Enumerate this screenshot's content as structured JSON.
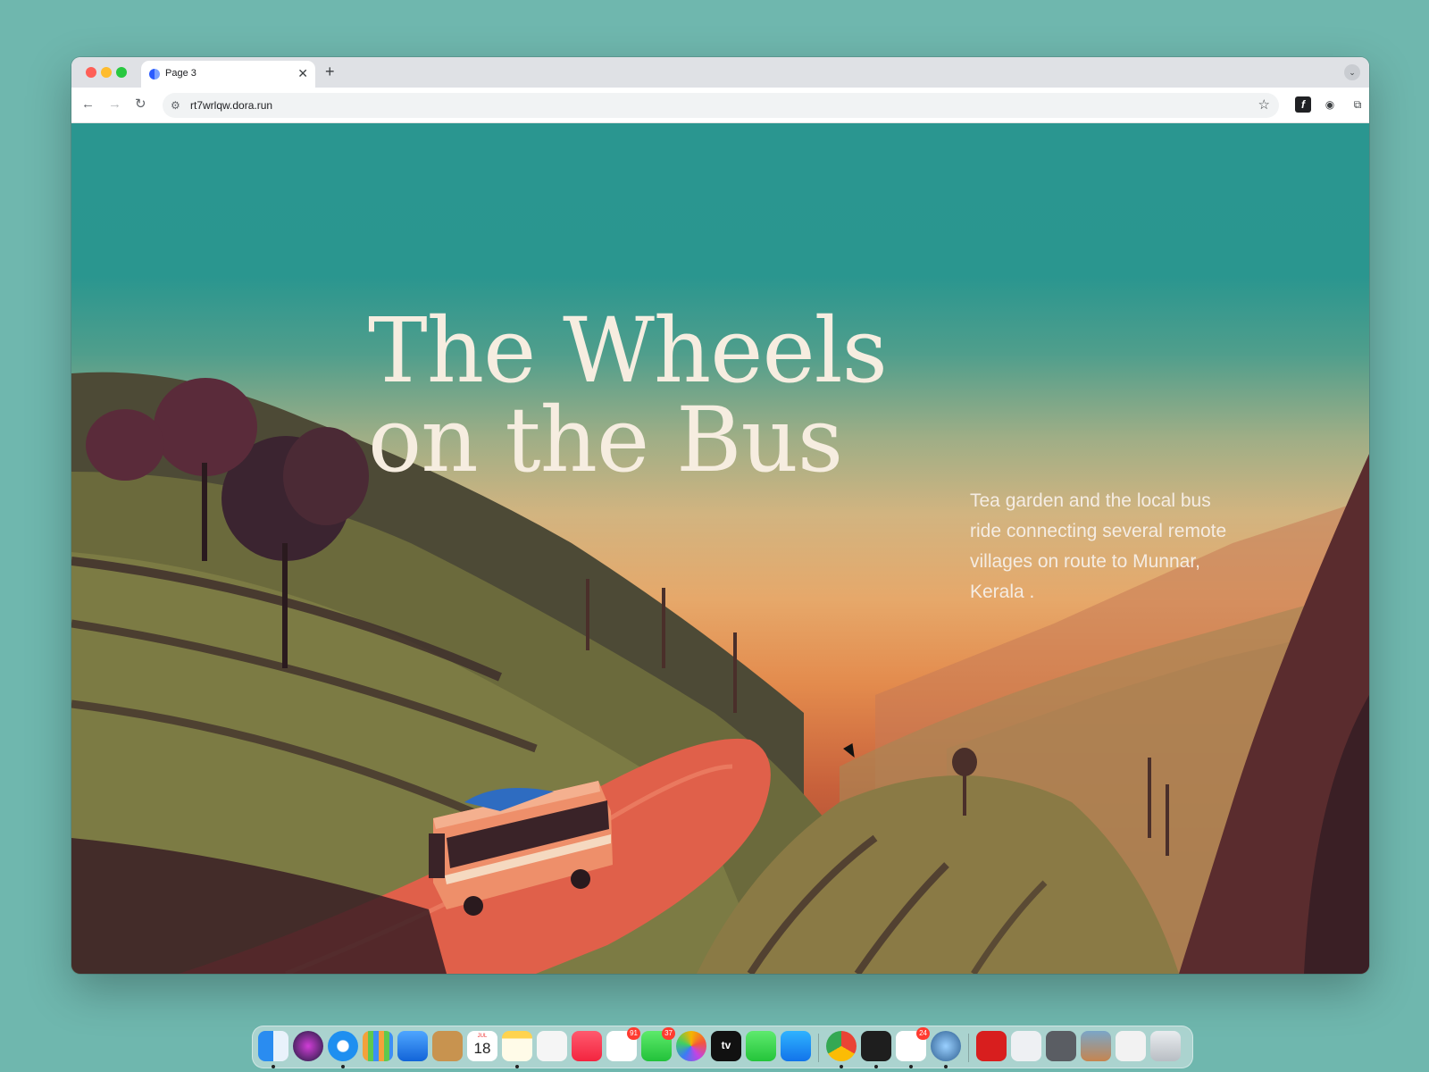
{
  "browser": {
    "tab_title": "Page 3",
    "new_tab_label": "+",
    "close_tab_label": "✕",
    "url": "rt7wrlqw.dora.run"
  },
  "hero": {
    "title_line1": "The Wheels",
    "title_line2": "on the Bus",
    "description": "Tea garden and the local bus ride connecting several remote villages on route to Munnar, Kerala ."
  },
  "dock": {
    "calendar_month": "JUL",
    "calendar_day": "18",
    "tv_label": "tv",
    "badges": {
      "reminders": "91",
      "messages": "37",
      "slack": "24"
    }
  },
  "icons": {
    "finder": "finder-icon",
    "siri": "siri-icon",
    "safari": "safari-icon",
    "launchpad": "launchpad-icon",
    "mail": "mail-icon",
    "contacts": "contacts-icon",
    "calendar": "calendar-icon",
    "notes": "notes-icon",
    "freeform": "freeform-icon",
    "music": "music-icon",
    "reminders": "reminders-icon",
    "messages": "messages-icon",
    "photos": "photos-icon",
    "appletv": "appletv-icon",
    "facetime": "facetime-icon",
    "appstore": "appstore-icon",
    "chrome": "chrome-icon",
    "figma": "figma-icon",
    "slack": "slack-icon",
    "quicktime": "quicktime-icon",
    "acrobat": "acrobat-icon",
    "trash": "trash-icon"
  },
  "colors": {
    "desktop": "#6fb7ae",
    "sky_top": "#2a9690",
    "title_text": "#f6ede0",
    "road": "#e0604a",
    "bus_body": "#ee8f6a"
  }
}
